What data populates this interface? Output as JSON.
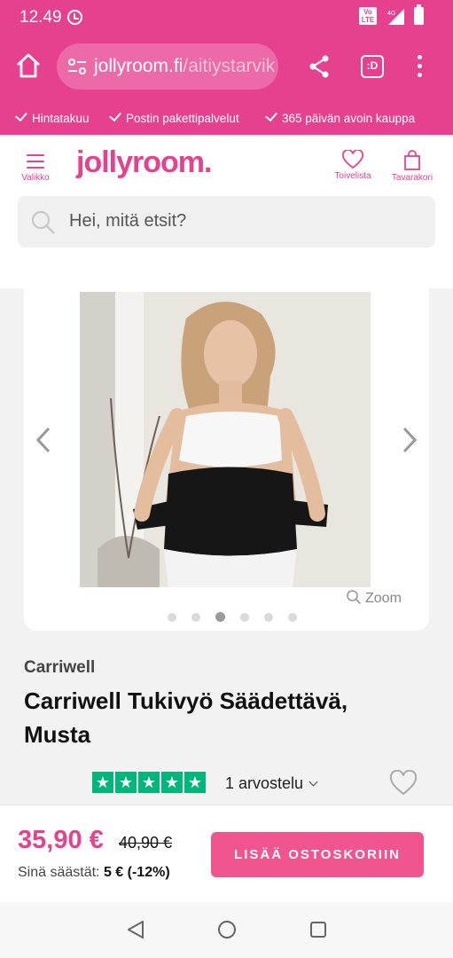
{
  "status_bar": {
    "time": "12.49",
    "network_badge": "Vo LTE",
    "network_type": "4G"
  },
  "browser": {
    "url_domain": "jollyroom.fi",
    "url_path": "/aitiystarvik",
    "tab_label": ":D"
  },
  "usp_bar": {
    "items": [
      "Hintatakuu",
      "Postin pakettipalvelut",
      "365 päivän avoin kauppa"
    ]
  },
  "header": {
    "menu_label": "Valikko",
    "logo_text": "jollyroom.",
    "wishlist_label": "Toivelista",
    "cart_label": "Tavarakori"
  },
  "search": {
    "placeholder": "Hei, mitä etsit?"
  },
  "gallery": {
    "zoom_label": "Zoom",
    "image_count": 6,
    "active_index": 2
  },
  "product": {
    "brand": "Carriwell",
    "title": "Carriwell Tukivyö Säädettävä, Musta",
    "rating_stars": 5,
    "reviews_label": "1 arvostelu"
  },
  "purchase": {
    "price": "35,90 €",
    "old_price": "40,90 €",
    "saving_prefix": "Sinä säästät:",
    "saving_value": "5 € (-12%)",
    "add_to_cart_label": "LISÄÄ OSTOSKORIIN"
  },
  "colors": {
    "brand_pink": "#e6418f",
    "trustpilot_green": "#00b67a"
  }
}
